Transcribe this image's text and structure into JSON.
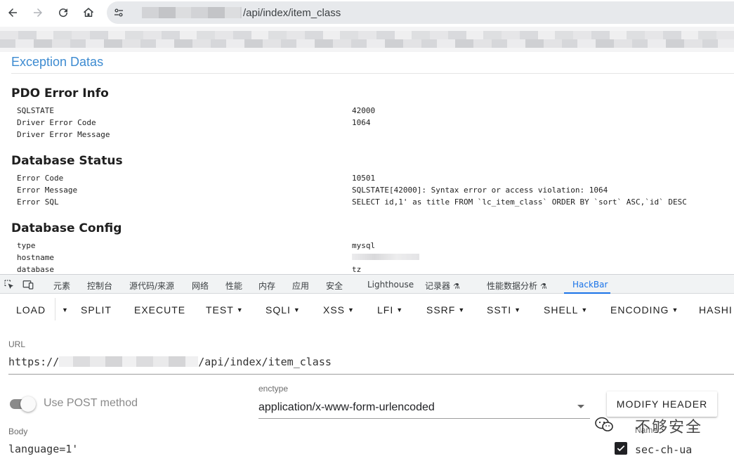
{
  "browser": {
    "url_path": "/api/index/item_class"
  },
  "page": {
    "exception_title": "Exception Datas",
    "sections": [
      {
        "heading": "PDO Error Info",
        "rows": [
          {
            "key": "SQLSTATE",
            "value": "42000"
          },
          {
            "key": "Driver Error Code",
            "value": "1064"
          },
          {
            "key": "Driver Error Message",
            "value": ""
          }
        ]
      },
      {
        "heading": "Database Status",
        "rows": [
          {
            "key": "Error Code",
            "value": "10501"
          },
          {
            "key": "Error Message",
            "value": "SQLSTATE[42000]: Syntax error or access violation: 1064"
          },
          {
            "key": "Error SQL",
            "value": "SELECT id,1' as title FROM `lc_item_class` ORDER BY `sort` ASC,`id` DESC"
          }
        ]
      },
      {
        "heading": "Database Config",
        "rows": [
          {
            "key": "type",
            "value": "mysql"
          },
          {
            "key": "hostname",
            "value": ""
          },
          {
            "key": "database",
            "value": "tz"
          }
        ]
      }
    ]
  },
  "devtools": {
    "tabs": [
      "元素",
      "控制台",
      "源代码/来源",
      "网络",
      "性能",
      "内存",
      "应用",
      "安全",
      "Lighthouse",
      "记录器",
      "性能数据分析",
      "HackBar"
    ],
    "active_tab": "HackBar"
  },
  "hackbar": {
    "menu": [
      "LOAD",
      "SPLIT",
      "EXECUTE",
      "TEST",
      "SQLI",
      "XSS",
      "LFI",
      "SSRF",
      "SSTI",
      "SHELL",
      "ENCODING",
      "HASHI"
    ],
    "url_label": "URL",
    "url_prefix": "https://",
    "url_path": "/api/index/item_class",
    "post_label": "Use POST method",
    "post_enabled": false,
    "enctype_label": "enctype",
    "enctype_value": "application/x-www-form-urlencoded",
    "modify_header_label": "MODIFY HEADER",
    "body_label": "Body",
    "body_value": "language=1'",
    "header_name_label": "Name",
    "header_name": "sec-ch-ua",
    "header_checked": true
  },
  "watermark": {
    "text": "不够安全"
  },
  "colors": {
    "link_blue": "#3d8bd1",
    "accent_blue": "#1a73e8"
  }
}
